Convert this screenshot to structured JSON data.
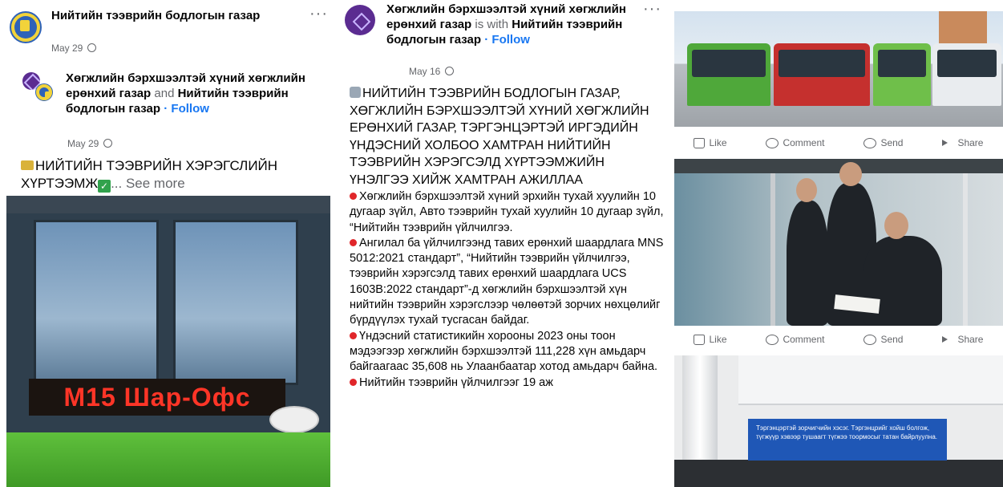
{
  "post1": {
    "page_name": "Нийтийн тээврийн бодлогын газар",
    "date": "May 29",
    "shared_org": "Хөгжлийн бэрхшээлтэй хүний хөгжлийн ерөнхий газар",
    "and_text": "and",
    "co_page": "Нийтийн тээврийн бодлогын газар",
    "follow": "· Follow",
    "shared_date": "May 29",
    "text": "НИЙТИЙН ТЭЭВРИЙН ХЭРЭГСЛИЙН ХҮРТЭЭМЖ",
    "see_more": "... See more",
    "bus_sign": "М15 Шар-Офс"
  },
  "post2": {
    "org_name": "Хөгжлийн бэрхшээлтэй хүний хөгжлийн ерөнхий газар",
    "with_text": "is with",
    "with_page": "Нийтийн тээврийн бодлогын газар",
    "follow": "· Follow",
    "date": "May 16",
    "heading": "НИЙТИЙН ТЭЭВРИЙН БОДЛОГЫН ГАЗАР, ХӨГЖЛИЙН БЭРХШЭЭЛТЭЙ ХҮНИЙ ХӨГЖЛИЙН ЕРӨНХИЙ ГАЗАР, ТЭРГЭНЦЭРТЭЙ ИРГЭДИЙН ҮНДЭСНИЙ ХОЛБОО ХАМТРАН НИЙТИЙН ТЭЭВРИЙН ХЭРЭГСЭЛД ХҮРТЭЭМЖИЙН ҮНЭЛГЭЭ ХИЙЖ ХАМТРАН АЖИЛЛАА",
    "para1": "Хөгжлийн бэрхшээлтэй хүний эрхийн тухай хуулийн 10 дугаар зүйл, Авто тээврийн тухай хуулийн 10 дугаар зүйл, “Нийтийн тээврийн үйлчилгээ.",
    "para2": "Ангилал ба үйлчилгээнд тавих ерөнхий шаардлага MNS 5012:2021 стандарт”, “Нийтийн тээврийн үйлчилгээ, тээврийн хэрэгсэлд тавих ерөнхий шаардлага UCS 1603B:2022 стандарт”-д хөгжлийн бэрхшээлтэй хүн нийтийн тээврийн хэрэгслээр чөлөөтэй зорчих нөхцөлийг бүрдүүлэх тухай тусгасан байдаг.",
    "para3": "Үндэсний статистикийн хорооны 2023 оны тоон мэдээгээр хөгжлийн бэрхшээлтэй 111,228 хүн амьдарч байгаагаас 35,608 нь Улаанбаатар хотод амьдарч байна.",
    "para4": "Нийтийн тээврийн үйлчилгээг 19 аж"
  },
  "actions": {
    "like": "Like",
    "comment": "Comment",
    "send": "Send",
    "share": "Share"
  },
  "post3": {
    "sign_text": "Тэргэнцэртэй зорчигчийн хэсэг. Тэргэнцрийг хойш болгож, түгжүүр хэвээр тушаагт түгжээ тоормосыг татан байрлуулна."
  }
}
